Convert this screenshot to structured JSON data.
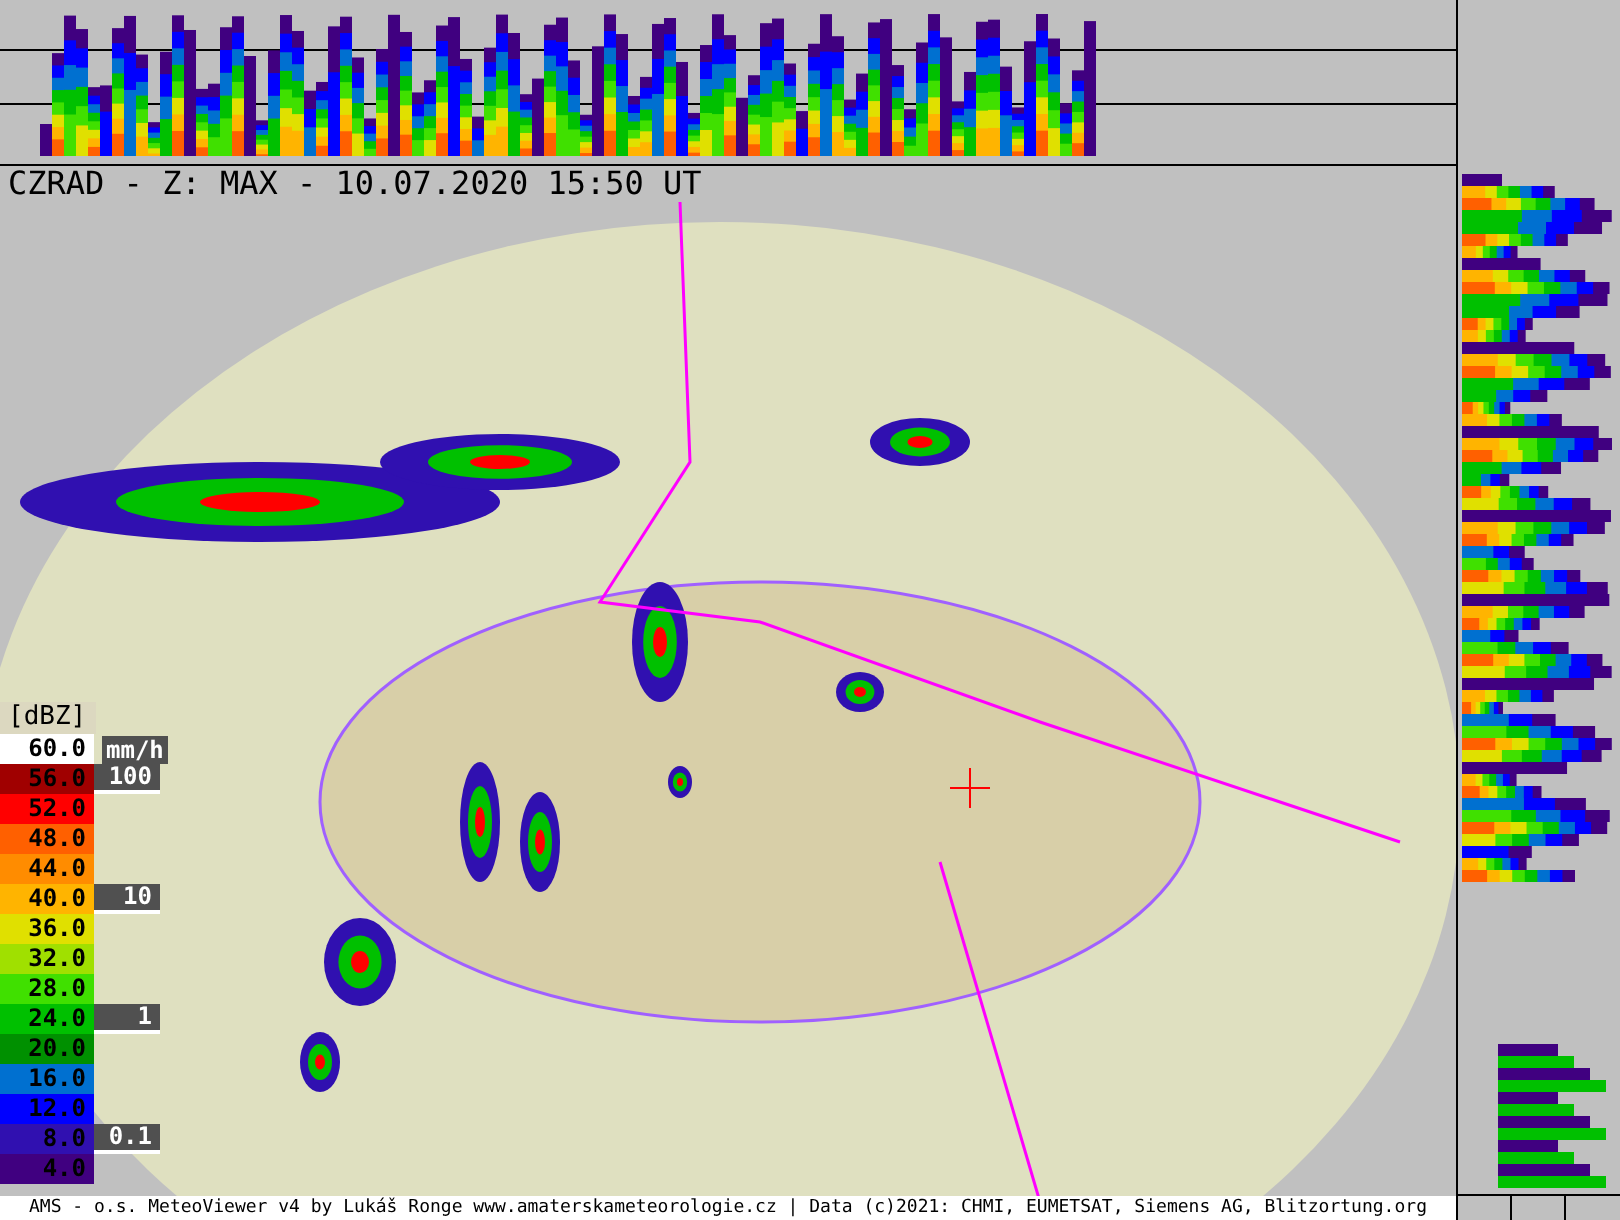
{
  "title": "CZRAD - Z: MAX - 10.07.2020 15:50 UT",
  "legend": {
    "unit": "[dBZ]",
    "rain_unit": "mm/h",
    "items": [
      {
        "value": "60.0",
        "color": "#ffffff"
      },
      {
        "value": "56.0",
        "color": "#a00000",
        "rain": "100"
      },
      {
        "value": "52.0",
        "color": "#ff0000"
      },
      {
        "value": "48.0",
        "color": "#ff6000"
      },
      {
        "value": "44.0",
        "color": "#ff8c00"
      },
      {
        "value": "40.0",
        "color": "#ffb400",
        "rain": "10"
      },
      {
        "value": "36.0",
        "color": "#e0e000"
      },
      {
        "value": "32.0",
        "color": "#a0e000"
      },
      {
        "value": "28.0",
        "color": "#40e000"
      },
      {
        "value": "24.0",
        "color": "#00c000",
        "rain": "1"
      },
      {
        "value": "20.0",
        "color": "#009000"
      },
      {
        "value": "16.0",
        "color": "#0070d0"
      },
      {
        "value": "12.0",
        "color": "#0000ff"
      },
      {
        "value": "8.0",
        "color": "#3010b0",
        "rain": "0.1"
      },
      {
        "value": "4.0",
        "color": "#400080"
      }
    ]
  },
  "footer": "AMS - o.s. MeteoViewer v4 by Lukáš Ronge www.amaterskameteorologie.cz | Data (c)2021: CHMI, EUMETSAT, Siemens AG, Blitzortung.org"
}
